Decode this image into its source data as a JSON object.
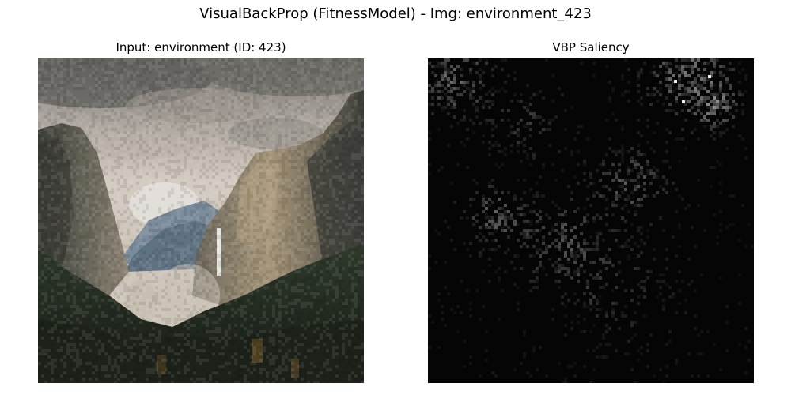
{
  "figure": {
    "suptitle": "VisualBackProp (FitnessModel) - Img: environment_423"
  },
  "panels": [
    {
      "title": "Input: environment (ID: 423)"
    },
    {
      "title": "VBP Saliency"
    }
  ],
  "colors": {
    "background": "#ffffff",
    "text": "#000000",
    "saliency_background": "#050505"
  }
}
